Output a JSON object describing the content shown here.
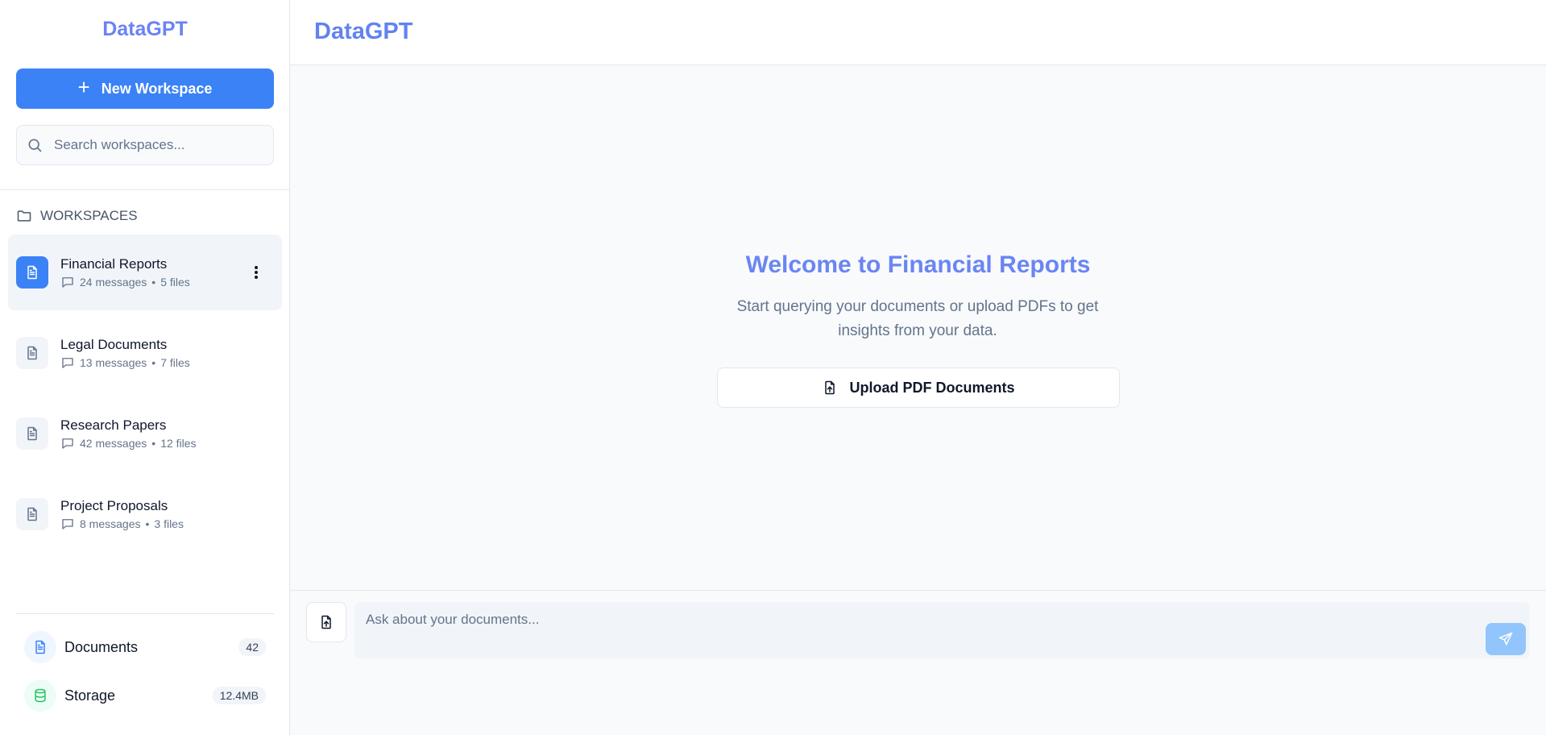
{
  "app": {
    "brand": "DataGPT"
  },
  "sidebar": {
    "brand": "DataGPT",
    "new_workspace_label": "New Workspace",
    "search_placeholder": "Search workspaces...",
    "workspaces_header": "WORKSPACES",
    "workspaces": [
      {
        "title": "Financial Reports",
        "messages": "24 messages",
        "files": "5 files",
        "active": true
      },
      {
        "title": "Legal Documents",
        "messages": "13 messages",
        "files": "7 files",
        "active": false
      },
      {
        "title": "Research Papers",
        "messages": "42 messages",
        "files": "12 files",
        "active": false
      },
      {
        "title": "Project Proposals",
        "messages": "8 messages",
        "files": "3 files",
        "active": false
      }
    ],
    "footer": {
      "documents_label": "Documents",
      "documents_count": "42",
      "storage_label": "Storage",
      "storage_value": "12.4MB"
    }
  },
  "main": {
    "brand": "DataGPT",
    "welcome_title": "Welcome to Financial Reports",
    "welcome_subtitle": "Start querying your documents or upload PDFs to get insights from your data.",
    "upload_label": "Upload PDF Documents",
    "chat_placeholder": "Ask about your documents..."
  },
  "icons": {
    "plus": "plus-icon",
    "search": "search-icon",
    "folder": "folder-icon",
    "file": "file-text-icon",
    "message": "message-square-icon",
    "more": "more-vertical-icon",
    "upload": "file-upload-icon",
    "database": "database-icon",
    "send": "send-icon"
  },
  "colors": {
    "accent": "#3b82f6",
    "brand_gradient_start": "#3b82f6",
    "brand_gradient_end": "#8b5cf6",
    "send_disabled": "#93c5fd",
    "storage_green": "#22c55e"
  }
}
